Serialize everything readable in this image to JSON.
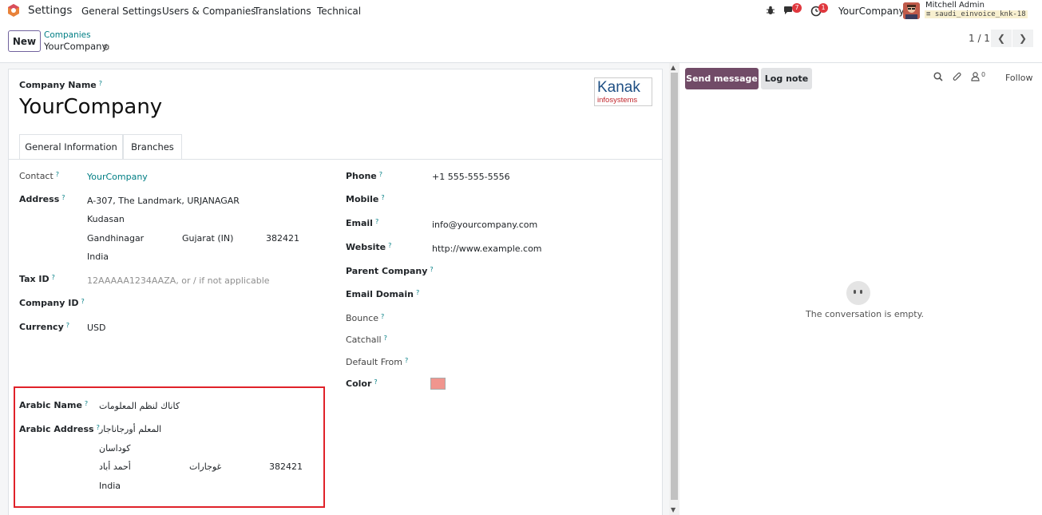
{
  "topbar": {
    "app_name": "Settings",
    "menu": [
      "General Settings",
      "Users & Companies",
      "Translations",
      "Technical"
    ],
    "messages_badge": "7",
    "activities_badge": "1",
    "company": "YourCompany",
    "user_name": "Mitchell Admin",
    "database": "saudi_einvoice_knk-18"
  },
  "control_panel": {
    "new_label": "New",
    "breadcrumb_parent": "Companies",
    "breadcrumb_current": "YourCompany",
    "pager": "1 / 1"
  },
  "form": {
    "company_name_label": "Company Name",
    "company_name": "YourCompany",
    "logo_text_top": "Kanak",
    "logo_text_bottom": "infosystems",
    "tabs": [
      "General Information",
      "Branches"
    ],
    "left": {
      "contact_label": "Contact",
      "contact": "YourCompany",
      "address_label": "Address",
      "street": "A-307, The Landmark, URJANAGAR",
      "street2": "Kudasan",
      "city": "Gandhinagar",
      "state": "Gujarat (IN)",
      "zip": "382421",
      "country": "India",
      "taxid_label": "Tax ID",
      "taxid_placeholder": "12AAAAA1234AAZA, or / if not applicable",
      "companyid_label": "Company ID",
      "currency_label": "Currency",
      "currency": "USD"
    },
    "right": {
      "phone_label": "Phone",
      "phone": "+1 555-555-5556",
      "mobile_label": "Mobile",
      "email_label": "Email",
      "email": "info@yourcompany.com",
      "website_label": "Website",
      "website": "http://www.example.com",
      "parent_label": "Parent Company",
      "domain_label": "Email Domain",
      "bounce_label": "Bounce",
      "catchall_label": "Catchall",
      "default_from_label": "Default From",
      "color_label": "Color",
      "color_value": "#f0958e"
    },
    "arabic": {
      "name_label": "Arabic Name",
      "name": "كاناك لنظم المعلومات",
      "address_label": "Arabic Address",
      "street": "المعلم أورجاناجار",
      "street2": "كوداسان",
      "city": "أحمد أباد",
      "state": "غوجارات",
      "zip": "382421",
      "country": "India"
    }
  },
  "chatter": {
    "send_label": "Send message",
    "log_label": "Log note",
    "followers_count": "0",
    "follow_label": "Follow",
    "empty_text": "The conversation is empty."
  },
  "colors": {
    "brand": "#714b67",
    "link": "#017e84",
    "highlight_border": "#e0222a"
  }
}
